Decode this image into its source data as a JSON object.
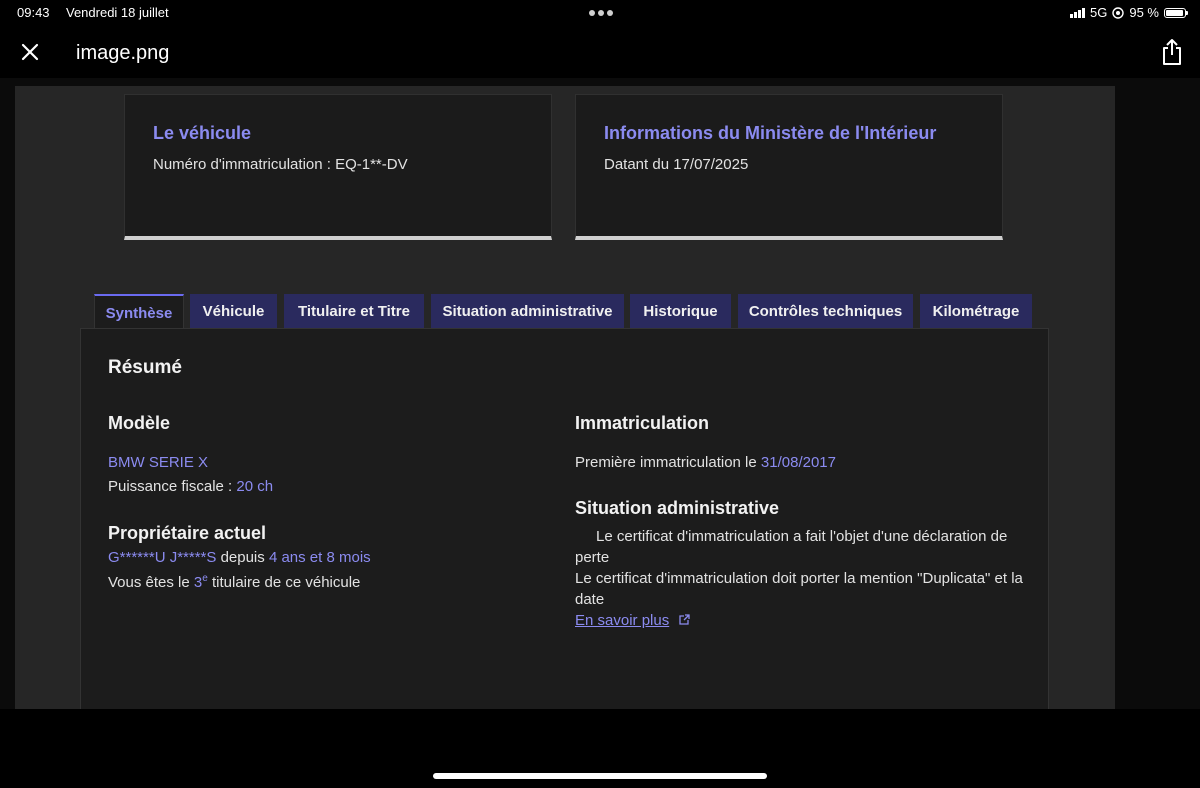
{
  "status_bar": {
    "time": "09:43",
    "date": "Vendredi 18 juillet",
    "network": "5G",
    "battery": "95 %",
    "battery_level": 0.95
  },
  "viewer": {
    "filename": "image.png",
    "close_icon": "close-icon",
    "share_icon": "share-icon"
  },
  "cards": [
    {
      "title": "Le véhicule",
      "subtitle": "Numéro d'immatriculation : EQ-1**-DV"
    },
    {
      "title": "Informations du Ministère de l'Intérieur",
      "subtitle": "Datant du 17/07/2025"
    }
  ],
  "tabs": [
    {
      "label": "Synthèse",
      "active": true
    },
    {
      "label": "Véhicule"
    },
    {
      "label": "Titulaire et Titre"
    },
    {
      "label": "Situation administrative"
    },
    {
      "label": "Historique"
    },
    {
      "label": "Contrôles techniques"
    },
    {
      "label": "Kilométrage"
    }
  ],
  "summary": {
    "heading": "Résumé",
    "model": {
      "heading": "Modèle",
      "name": "BMW SERIE X",
      "power_label": "Puissance fiscale :",
      "power_value": "20 ch"
    },
    "owner": {
      "heading": "Propriétaire actuel",
      "name": "G******U J*****S",
      "since_label": "depuis",
      "since_value": "4 ans et 8 mois",
      "rank_prefix": "Vous êtes le",
      "rank_number": "3",
      "rank_suffix": "e",
      "rank_rest": "titulaire de ce véhicule"
    },
    "registration": {
      "heading": "Immatriculation",
      "first_label": "Première immatriculation le",
      "first_date": "31/08/2017"
    },
    "admin": {
      "heading": "Situation administrative",
      "line1": "Le certificat d'immatriculation a fait l'objet d'une déclaration de perte",
      "line2": "Le certificat d'immatriculation doit porter la mention \"Duplicata\" et la date",
      "link": "En savoir plus",
      "link_icon": "external-link-icon"
    }
  },
  "colors": {
    "accent": "#8b8bf0",
    "tab_bg": "#2a2a5e",
    "card_bg": "#1b1b1b",
    "page_bg": "#262626"
  }
}
